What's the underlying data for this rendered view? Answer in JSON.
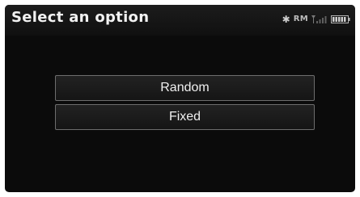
{
  "header": {
    "title": "Select an option",
    "status": {
      "bluetooth_icon": "bluetooth-icon",
      "rm_label": "RM",
      "signal_icon": "signal-strength-icon",
      "battery_icon": "battery-icon"
    }
  },
  "options": [
    {
      "label": "Random"
    },
    {
      "label": "Fixed"
    }
  ],
  "colors": {
    "screen_background": "#0b0b0b",
    "text": "#f0f0f0",
    "button_border": "#6d6d6d"
  }
}
